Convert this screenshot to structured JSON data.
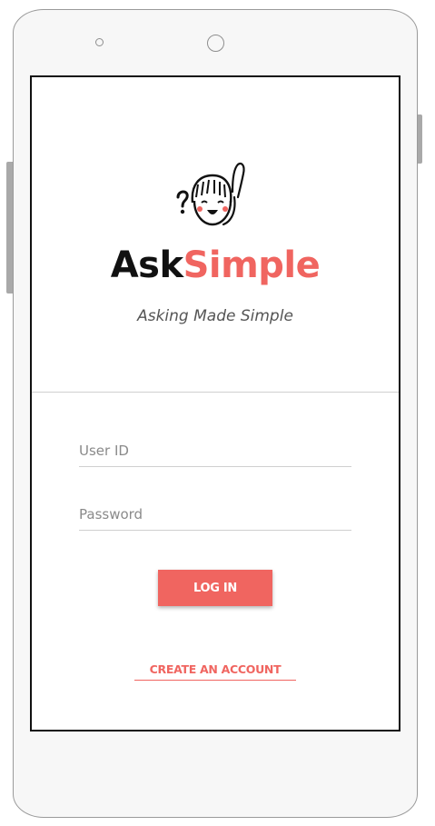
{
  "brand": {
    "name_part1": "Ask",
    "name_part2": "Simple",
    "tagline": "Asking Made Simple",
    "accent_color": "#f06560",
    "mascot_icon": "girl-mascot-with-question-mark"
  },
  "login_form": {
    "user_id_placeholder": "User ID",
    "password_placeholder": "Password",
    "login_label": "LOG IN",
    "create_account_label": "CREATE AN ACCOUNT"
  }
}
